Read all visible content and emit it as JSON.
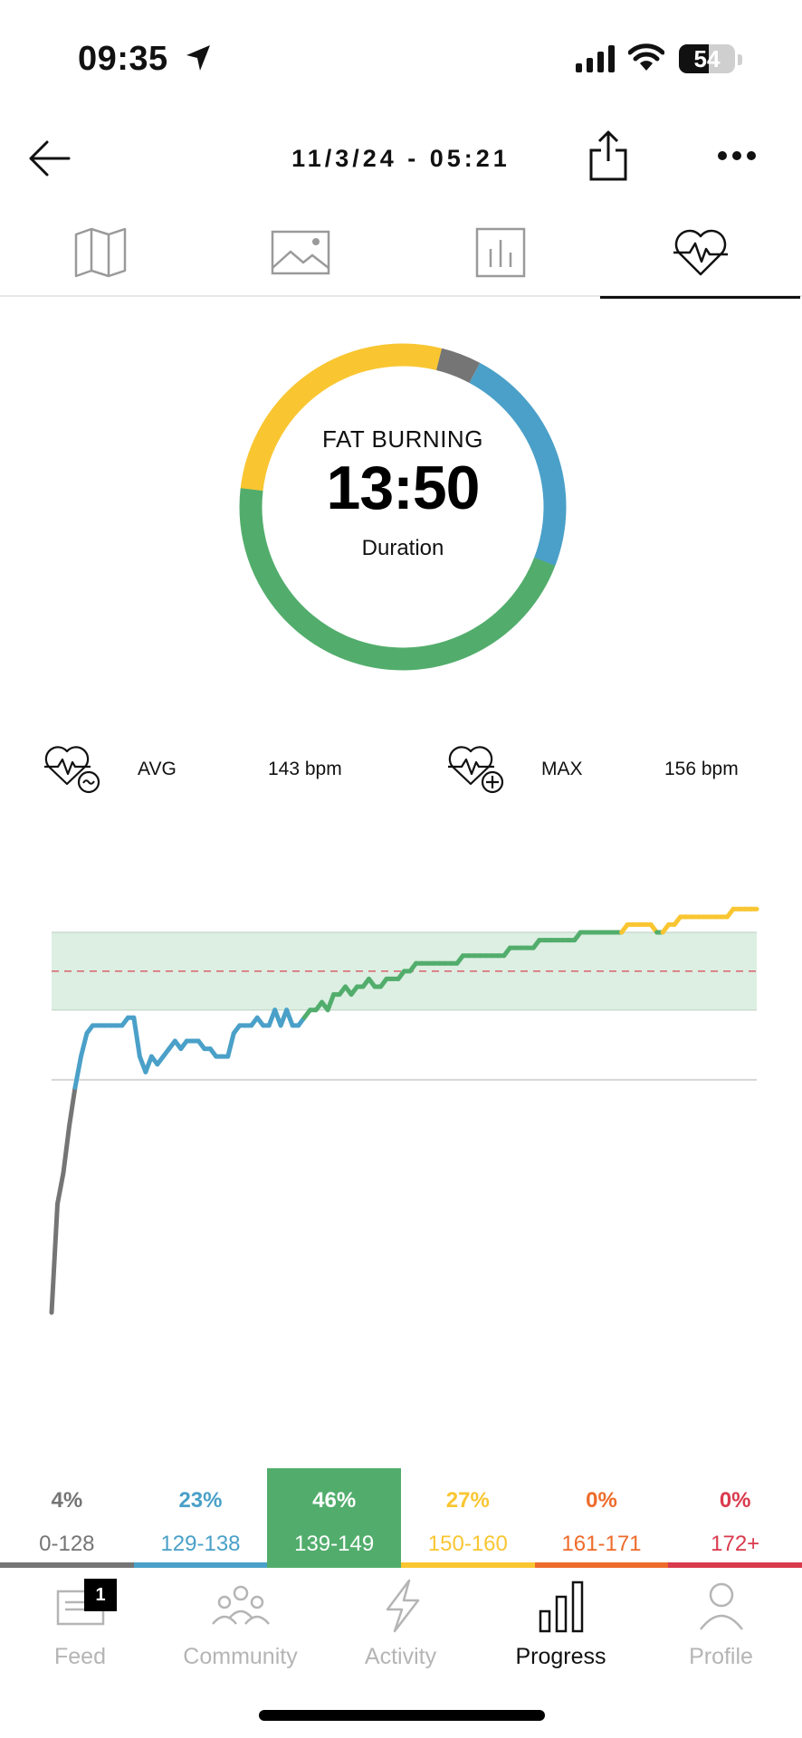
{
  "status_bar": {
    "time": "09:35",
    "battery": "54",
    "battery_level": 0.54
  },
  "header": {
    "title": "11/3/24 - 05:21",
    "icons": [
      "back-arrow-icon",
      "share-icon",
      "more-icon"
    ]
  },
  "tabs": [
    {
      "icon": "map-icon",
      "active": false
    },
    {
      "icon": "image-icon",
      "active": false
    },
    {
      "icon": "bar-chart-icon",
      "active": false
    },
    {
      "icon": "heart-rate-icon",
      "active": true
    }
  ],
  "summary": {
    "zone_label": "FAT BURNING",
    "duration_value": "13:50",
    "duration_label": "Duration"
  },
  "stats": {
    "avg_label": "AVG",
    "avg_value": "143 bpm",
    "max_label": "MAX",
    "max_value": "156 bpm"
  },
  "zones": [
    {
      "percent": "4%",
      "range": "0-128",
      "color": "#757575",
      "fraction": 0.04,
      "highlighted": false
    },
    {
      "percent": "23%",
      "range": "129-138",
      "color": "#4aa0c8",
      "fraction": 0.23,
      "highlighted": false
    },
    {
      "percent": "46%",
      "range": "139-149",
      "color": "#52ad6c",
      "fraction": 0.46,
      "highlighted": true
    },
    {
      "percent": "27%",
      "range": "150-160",
      "color": "#f9c632",
      "fraction": 0.27,
      "highlighted": false
    },
    {
      "percent": "0%",
      "range": "161-171",
      "color": "#ee6b2b",
      "fraction": 0.0,
      "highlighted": false
    },
    {
      "percent": "0%",
      "range": "172+",
      "color": "#d93b4e",
      "fraction": 0.0,
      "highlighted": false
    }
  ],
  "chart_data": {
    "type": "line",
    "x": [
      0,
      1,
      2,
      3,
      4,
      5,
      6,
      7,
      8,
      9,
      10,
      11,
      12,
      13,
      14,
      15,
      16,
      17,
      18,
      19,
      20,
      21,
      22,
      23,
      24,
      25,
      26,
      27,
      28,
      29,
      30,
      31,
      32,
      33,
      34,
      35,
      36,
      37,
      38,
      39,
      40,
      41,
      42,
      43,
      44,
      45,
      46,
      47,
      48,
      49,
      50,
      51,
      52,
      53,
      54,
      55,
      56,
      57,
      58,
      59,
      60,
      61,
      62,
      63,
      64,
      65,
      66,
      67,
      68,
      69,
      70,
      71,
      72,
      73,
      74,
      75,
      76,
      77,
      78,
      79,
      80,
      81,
      82,
      83,
      84,
      85,
      86,
      87,
      88,
      89,
      90,
      91,
      92,
      93,
      94,
      95,
      96,
      97,
      98,
      99,
      100,
      101,
      102,
      103,
      104,
      105,
      106,
      107,
      108,
      109,
      110,
      111,
      112,
      113,
      114,
      115,
      116,
      117,
      118,
      119,
      120
    ],
    "y": [
      100,
      114,
      118,
      124,
      129,
      133,
      136,
      137,
      137,
      137,
      137,
      137,
      137,
      138,
      138,
      133,
      131,
      133,
      132,
      133,
      134,
      135,
      134,
      135,
      135,
      135,
      134,
      134,
      133,
      133,
      133,
      136,
      137,
      137,
      137,
      138,
      137,
      137,
      139,
      137,
      139,
      137,
      137,
      138,
      139,
      139,
      140,
      139,
      141,
      141,
      142,
      141,
      142,
      142,
      143,
      142,
      142,
      143,
      143,
      143,
      144,
      144,
      145,
      145,
      145,
      145,
      145,
      145,
      145,
      145,
      146,
      146,
      146,
      146,
      146,
      146,
      146,
      146,
      147,
      147,
      147,
      147,
      147,
      148,
      148,
      148,
      148,
      148,
      148,
      148,
      149,
      149,
      149,
      149,
      149,
      149,
      149,
      149,
      150,
      150,
      150,
      150,
      150,
      149,
      149,
      150,
      150,
      151,
      151,
      151,
      151,
      151,
      151,
      151,
      151,
      151,
      152,
      152,
      152,
      152,
      152
    ],
    "zone_band": [
      139,
      149
    ],
    "ylim": [
      100,
      156
    ],
    "series_colors": [
      "#757575",
      "#4aa0c8",
      "#52ad6c",
      "#f9c632"
    ]
  },
  "tabbar": {
    "items": [
      {
        "label": "Feed",
        "icon": "feed-icon",
        "active": false,
        "badge": "1"
      },
      {
        "label": "Community",
        "icon": "community-icon",
        "active": false
      },
      {
        "label": "Activity",
        "icon": "activity-bolt-icon",
        "active": false
      },
      {
        "label": "Progress",
        "icon": "progress-bars-icon",
        "active": true
      },
      {
        "label": "Profile",
        "icon": "profile-icon",
        "active": false
      }
    ]
  }
}
